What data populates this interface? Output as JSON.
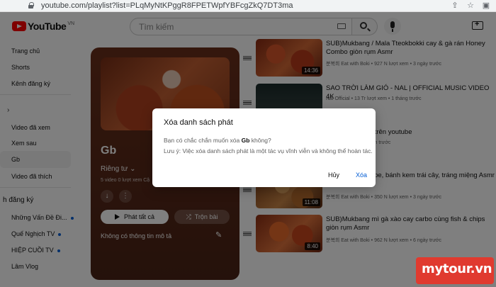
{
  "browser": {
    "url": "youtube.com/playlist?list=PLqMyNtKPggR8FPETWpfYBFcgZkQ7DT3ma"
  },
  "masthead": {
    "logo_text": "YouTube",
    "region": "VN",
    "search_placeholder": "Tìm kiếm"
  },
  "sidebar": {
    "items": [
      "Trang chủ",
      "Shorts",
      "Kênh đăng ký",
      "Video đã xem",
      "Xem sau",
      "Gb",
      "Video đã thích"
    ],
    "subscriptions_heading": "h đăng ký",
    "subscriptions": [
      "Những Vấn Đề Đi...",
      "Quế Nghịch TV",
      "HIỆP CUỒI TV",
      "Lâm Vlog"
    ]
  },
  "playlist": {
    "title": "Gb",
    "privacy": "Riêng tư",
    "meta": "5 video  0 lượt xem  Cậ",
    "play_all": "Phát tất cả",
    "shuffle": "Trộn bài",
    "description": "Không có thông tin mô tả"
  },
  "videos": [
    {
      "title": "SUB)Mukbang / Mala Tteokbokki cay & gà rán Honey Combo giòn rụm Asmr",
      "meta": "분복희 Eat with Boki • 927 N lượt xem • 3 ngày trước",
      "duration": "14:36"
    },
    {
      "title": "SAO TRỜI LÀM GIÓ - NAL | OFFICIAL MUSIC VIDEO 4K",
      "meta": "Nal Official • 13 Tr lượt xem • 1 tháng trước",
      "duration": ""
    },
    {
      "title": "ách phát đã lưu trên youtube",
      "meta": "6,2 N lượt xem • 2 năm trước",
      "duration": ""
    },
    {
      "title": "a, bánh kem crepe, bánh kem trái cây, tráng miệng Asmr",
      "meta": "분복희 Eat with Boki • 350 N lượt xem • 3 ngày trước",
      "duration": "11:08"
    },
    {
      "title": "SUB)Mukbang mì gà xào cay carbo cùng fish & chips giòn rụm Asmr",
      "meta": "분복희 Eat with Boki • 962 N lượt xem • 6 ngày trước",
      "duration": "8:40"
    }
  ],
  "dialog": {
    "title": "Xóa danh sách phát",
    "question_prefix": "Bạn có chắc chắn muốn xóa ",
    "question_name": "Gb",
    "question_suffix": " không?",
    "note": "Lưu ý: Việc xóa danh sách phát là một tác vụ vĩnh viễn và không thể hoàn tác.",
    "cancel": "Hủy",
    "delete": "Xóa"
  },
  "watermark": "mytour.vn"
}
